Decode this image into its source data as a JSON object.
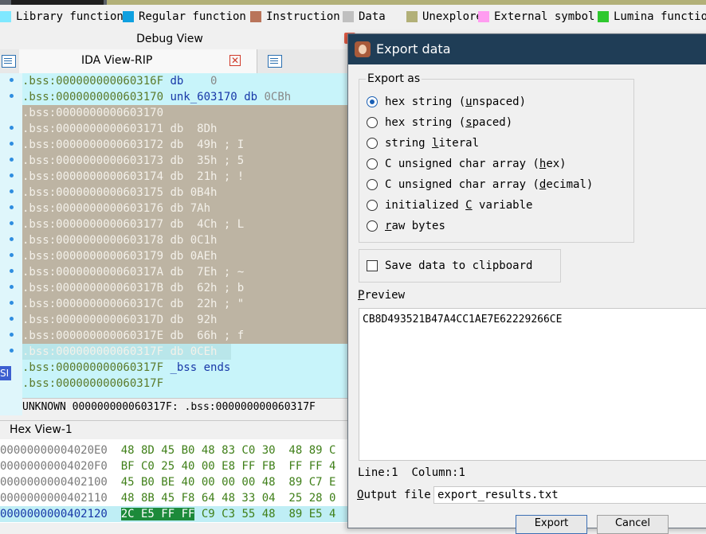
{
  "legend": [
    {
      "label": "Library function",
      "color": "#7fe8ff"
    },
    {
      "label": "Regular function",
      "color": "#0fa0e0"
    },
    {
      "label": "Instruction",
      "color": "#b9745a"
    },
    {
      "label": "Data",
      "color": "#c0c0c0"
    },
    {
      "label": "Unexplored",
      "color": "#b2b078"
    },
    {
      "label": "External symbol",
      "color": "#ff9cf0"
    },
    {
      "label": "Lumina function",
      "color": "#2ec82e"
    }
  ],
  "debug_view": {
    "title": "Debug View"
  },
  "ida_view": {
    "tab_label": "IDA View-RIP",
    "tab_close": "✕",
    "register_tag": "SI"
  },
  "disasm_lines": [
    {
      "text": ".bss:000000000060316F db    0",
      "style": "normal"
    },
    {
      "text": ".bss:0000000000603170 unk_603170 db 0CBh",
      "style": "normal"
    },
    {
      "text": ".bss:0000000000603170",
      "style": "sel"
    },
    {
      "text": ".bss:0000000000603171 db  8Dh",
      "style": "sel"
    },
    {
      "text": ".bss:0000000000603172 db  49h ; I",
      "style": "sel"
    },
    {
      "text": ".bss:0000000000603173 db  35h ; 5",
      "style": "sel"
    },
    {
      "text": ".bss:0000000000603174 db  21h ; !",
      "style": "sel"
    },
    {
      "text": ".bss:0000000000603175 db 0B4h",
      "style": "sel"
    },
    {
      "text": ".bss:0000000000603176 db 7Ah",
      "style": "sel"
    },
    {
      "text": ".bss:0000000000603177 db  4Ch ; L",
      "style": "sel"
    },
    {
      "text": ".bss:0000000000603178 db 0C1h",
      "style": "sel"
    },
    {
      "text": ".bss:0000000000603179 db 0AEh",
      "style": "sel"
    },
    {
      "text": ".bss:000000000060317A db  7Eh ; ~",
      "style": "sel"
    },
    {
      "text": ".bss:000000000060317B db  62h ; b",
      "style": "sel"
    },
    {
      "text": ".bss:000000000060317C db  22h ; \"",
      "style": "sel"
    },
    {
      "text": ".bss:000000000060317D db  92h",
      "style": "sel"
    },
    {
      "text": ".bss:000000000060317E db  66h ; f",
      "style": "sel"
    },
    {
      "text": ".bss:000000000060317F db 0CEh",
      "style": "last"
    },
    {
      "text": ".bss:000000000060317F _bss ends",
      "style": "normal"
    },
    {
      "text": ".bss:000000000060317F",
      "style": "normal"
    }
  ],
  "status_line": "UNKNOWN 000000000060317F: .bss:000000000060317F",
  "hex_view": {
    "title": "Hex View-1",
    "rows": [
      {
        "addr": "00000000004020E0",
        "bytes": "48 8D 45 B0 48 83 C0 30  48 89 C"
      },
      {
        "addr": "00000000004020F0",
        "bytes": "BF C0 25 40 00 E8 FF FB  FF FF 4"
      },
      {
        "addr": "0000000000402100",
        "bytes": "45 B0 BE 40 00 00 00 48  89 C7 E"
      },
      {
        "addr": "0000000000402110",
        "bytes": "48 8B 45 F8 64 48 33 04  25 28 0"
      },
      {
        "addr": "0000000000402120",
        "sel": "2C E5 FF FF",
        "bytes": " C9 C3 55 48  89 E5 4"
      }
    ]
  },
  "export_dialog": {
    "title": "Export data",
    "group_label": "Export as",
    "options": [
      {
        "pre": "hex string (",
        "u": "u",
        "post": "nspaced)",
        "checked": true
      },
      {
        "pre": "hex string (",
        "u": "s",
        "post": "paced)",
        "checked": false
      },
      {
        "pre": "string ",
        "u": "l",
        "post": "iteral",
        "checked": false
      },
      {
        "pre": "C unsigned char array (",
        "u": "h",
        "post": "ex)",
        "checked": false
      },
      {
        "pre": "C unsigned char array (",
        "u": "d",
        "post": "ecimal)",
        "checked": false
      },
      {
        "pre": "initialized ",
        "u": "C",
        "post": " variable",
        "checked": false
      },
      {
        "pre": "",
        "u": "r",
        "post": "aw bytes",
        "checked": false
      }
    ],
    "clipboard_label": "Save data to clipboard",
    "clipboard_checked": false,
    "preview_label_u": "P",
    "preview_label_rest": "review",
    "preview_text": "CB8D493521B47A4CC1AE7E62229266CE",
    "line_label": "Line:1",
    "column_label": "Column:1",
    "output_label_u": "O",
    "output_label_rest": "utput file",
    "output_value": "export_results.txt",
    "export_button": "Export",
    "cancel_button": "Cancel"
  }
}
